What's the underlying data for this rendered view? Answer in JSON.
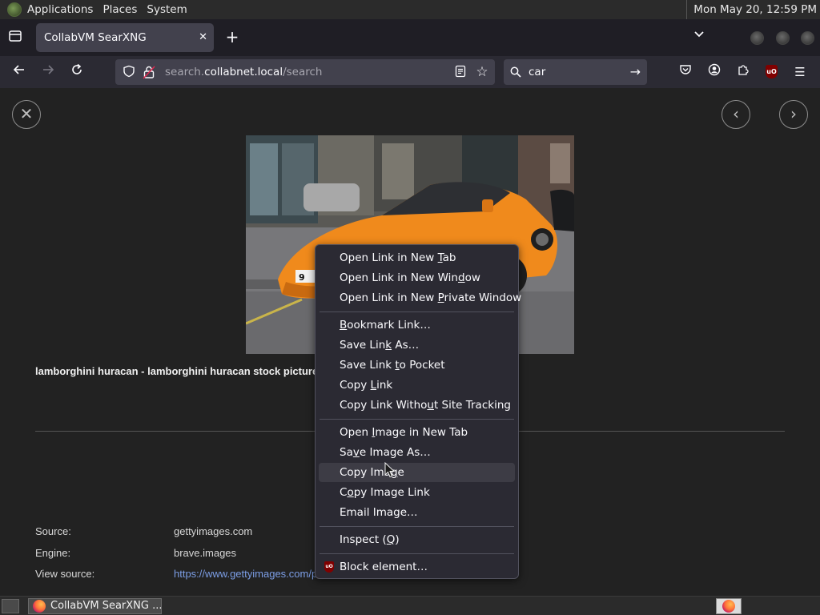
{
  "top_panel": {
    "menus": [
      "Applications",
      "Places",
      "System"
    ],
    "clock": "Mon May 20, 12:59 PM"
  },
  "browser": {
    "tab_title": "CollabVM SearXNG",
    "url_prefix": "search.",
    "url_host": "collabnet.local",
    "url_path": "/search",
    "search_query": "car"
  },
  "page": {
    "caption": "lamborghini huracan - lamborghini huracan stock picture",
    "image_plate": "9",
    "meta": [
      {
        "label": "Source:",
        "value": "gettyimages.com"
      },
      {
        "label": "Engine:",
        "value": "brave.images"
      },
      {
        "label": "View source:",
        "value": "https://www.gettyimages.com/p"
      }
    ]
  },
  "context_menu": {
    "items": [
      {
        "pre": "Open Link in New ",
        "key": "T",
        "post": "ab"
      },
      {
        "pre": "Open Link in New Win",
        "key": "d",
        "post": "ow"
      },
      {
        "pre": "Open Link in New ",
        "key": "P",
        "post": "rivate Window"
      },
      {
        "pre": "",
        "key": "B",
        "post": "ookmark Link…"
      },
      {
        "pre": "Save Lin",
        "key": "k",
        "post": " As…"
      },
      {
        "pre": "Save Link ",
        "key": "t",
        "post": "o Pocket"
      },
      {
        "pre": "Copy ",
        "key": "L",
        "post": "ink"
      },
      {
        "pre": "Copy Link Witho",
        "key": "u",
        "post": "t Site Tracking"
      },
      {
        "pre": "Open ",
        "key": "I",
        "post": "mage in New Tab"
      },
      {
        "pre": "Sa",
        "key": "v",
        "post": "e Image As…"
      },
      {
        "pre": "Copy Ima",
        "key": "g",
        "post": "e"
      },
      {
        "pre": "C",
        "key": "o",
        "post": "py Image Link"
      },
      {
        "pre": "Email Image…",
        "key": "",
        "post": ""
      },
      {
        "pre": "Inspect (",
        "key": "Q",
        "post": ")"
      },
      {
        "pre": "Block element…",
        "key": "",
        "post": ""
      }
    ]
  },
  "taskbar": {
    "window_title": "CollabVM SearXNG ..."
  },
  "colors": {
    "panel": "#2b2b2b",
    "tab_strip": "#1f1e25",
    "toolbar": "#2b2a33",
    "field": "#42414d",
    "page_bg": "#222222",
    "menu_bg": "#2b2a33",
    "link": "#7c9ee6",
    "car": "#f08a1c"
  }
}
